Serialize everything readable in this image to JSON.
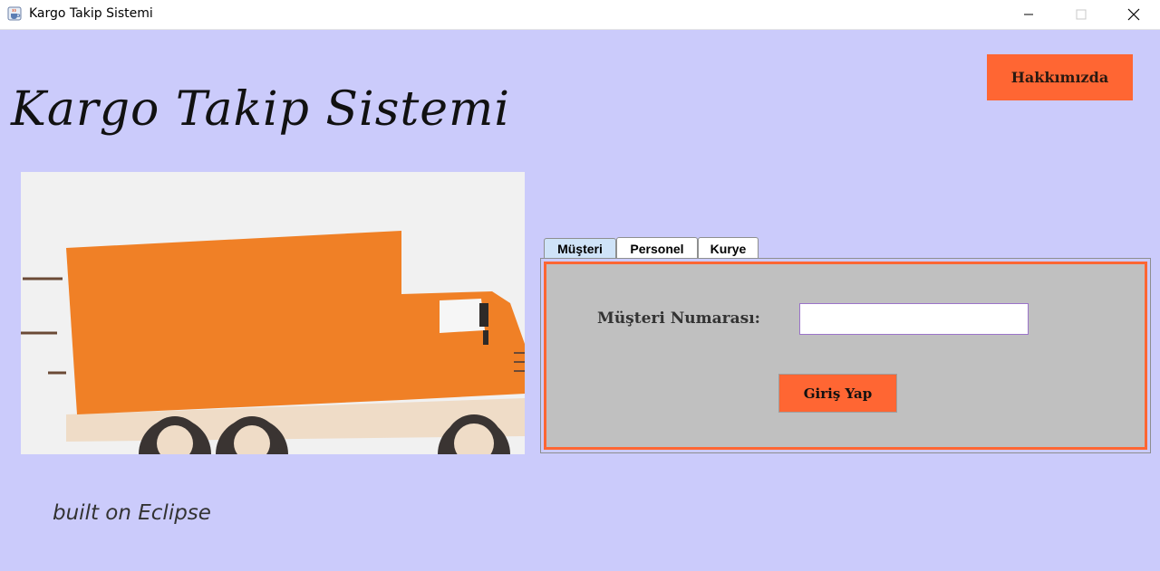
{
  "window": {
    "title": "Kargo Takip Sistemi",
    "icon": "java-cup-icon",
    "controls": [
      "minimize-icon",
      "maximize-icon",
      "close-icon"
    ]
  },
  "header": {
    "title": "Kargo Takip Sistemi",
    "about_label": "Hakkımızda"
  },
  "image": {
    "subject": "truck-image"
  },
  "tabs": [
    {
      "label": "Müşteri",
      "active": true
    },
    {
      "label": "Personel",
      "active": false
    },
    {
      "label": "Kurye",
      "active": false
    }
  ],
  "form": {
    "customer_number_label": "Müşteri Numarası:",
    "customer_number_value": "",
    "login_label": "Giriş Yap"
  },
  "footer": {
    "text": "built on Eclipse"
  },
  "colors": {
    "background": "#cbcbfb",
    "accent": "#ff6633",
    "panel": "#c0c0c0",
    "truck": "#f08026"
  }
}
